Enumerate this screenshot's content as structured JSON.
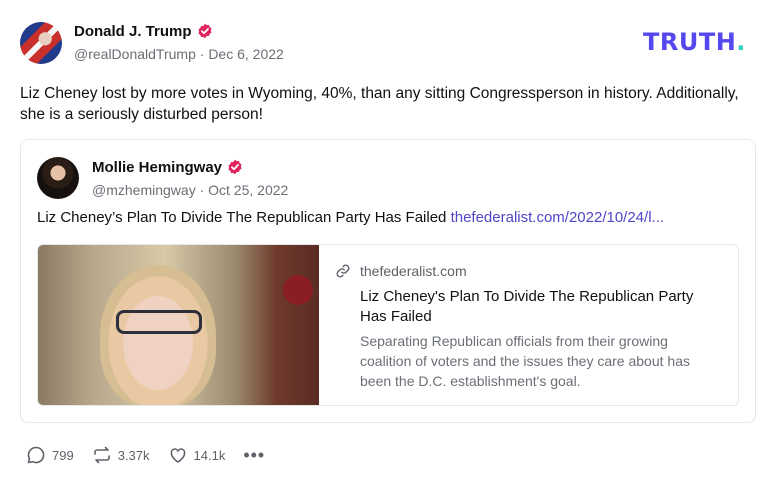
{
  "brand": {
    "logo_text": "TRUTH",
    "logo_dot": ".",
    "color": "#5448ee",
    "dot_color": "#2fcfbd"
  },
  "post": {
    "author_name": "Donald J. Trump",
    "handle": "@realDonaldTrump",
    "date": "Dec 6, 2022",
    "text": "Liz Cheney lost by more votes in Wyoming, 40%, than any sitting Congressperson in history. Additionally, she is a seriously disturbed person!",
    "verified_color": "#e0245e"
  },
  "quote": {
    "author_name": "Mollie Hemingway",
    "handle": "@mzhemingway",
    "date": "Oct 25, 2022",
    "text": "Liz Cheney’s Plan To Divide The Republican Party Has Failed",
    "link_text": "thefederalist.com/2022/10/24/l...",
    "card": {
      "domain": "thefederalist.com",
      "title": "Liz Cheney's Plan To Divide The Republican Party Has Failed",
      "description": "Separating Republican officials from their growing coalition of voters and the issues they care about has been the D.C. establishment's goal."
    }
  },
  "actions": {
    "replies": "799",
    "retruths": "3.37k",
    "likes": "14.1k",
    "more": "•••"
  }
}
